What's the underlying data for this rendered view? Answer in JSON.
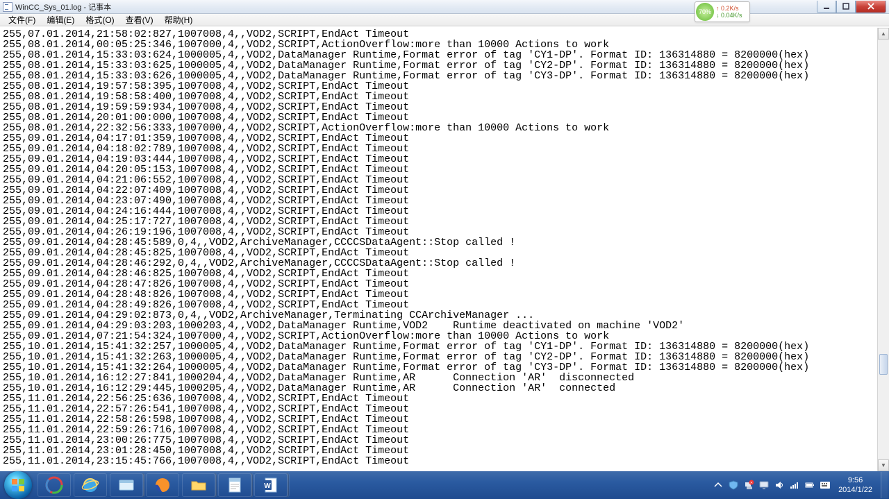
{
  "window": {
    "title": "WinCC_Sys_01.log - 记事本"
  },
  "menu": {
    "file": "文件(F)",
    "edit": "编辑(E)",
    "format": "格式(O)",
    "view": "查看(V)",
    "help": "帮助(H)"
  },
  "netmeter": {
    "pct": "70%",
    "up": "↑  0.2K/s",
    "dn": "↓ 0.04K/s"
  },
  "clock": {
    "time": "9:56",
    "date": "2014/1/22"
  },
  "log_lines": [
    "255,07.01.2014,21:58:02:827,1007008,4,,VOD2,SCRIPT,EndAct Timeout",
    "255,08.01.2014,00:05:25:346,1007000,4,,VOD2,SCRIPT,ActionOverflow:more than 10000 Actions to work",
    "255,08.01.2014,15:33:03:624,1000005,4,,VOD2,DataManager Runtime,Format error of tag 'CY1-DP'. Format ID: 136314880 = 8200000(hex)",
    "255,08.01.2014,15:33:03:625,1000005,4,,VOD2,DataManager Runtime,Format error of tag 'CY2-DP'. Format ID: 136314880 = 8200000(hex)",
    "255,08.01.2014,15:33:03:626,1000005,4,,VOD2,DataManager Runtime,Format error of tag 'CY3-DP'. Format ID: 136314880 = 8200000(hex)",
    "255,08.01.2014,19:57:58:395,1007008,4,,VOD2,SCRIPT,EndAct Timeout",
    "255,08.01.2014,19:58:58:400,1007008,4,,VOD2,SCRIPT,EndAct Timeout",
    "255,08.01.2014,19:59:59:934,1007008,4,,VOD2,SCRIPT,EndAct Timeout",
    "255,08.01.2014,20:01:00:000,1007008,4,,VOD2,SCRIPT,EndAct Timeout",
    "255,08.01.2014,22:32:56:333,1007000,4,,VOD2,SCRIPT,ActionOverflow:more than 10000 Actions to work",
    "255,09.01.2014,04:17:01:359,1007008,4,,VOD2,SCRIPT,EndAct Timeout",
    "255,09.01.2014,04:18:02:789,1007008,4,,VOD2,SCRIPT,EndAct Timeout",
    "255,09.01.2014,04:19:03:444,1007008,4,,VOD2,SCRIPT,EndAct Timeout",
    "255,09.01.2014,04:20:05:153,1007008,4,,VOD2,SCRIPT,EndAct Timeout",
    "255,09.01.2014,04:21:06:552,1007008,4,,VOD2,SCRIPT,EndAct Timeout",
    "255,09.01.2014,04:22:07:409,1007008,4,,VOD2,SCRIPT,EndAct Timeout",
    "255,09.01.2014,04:23:07:490,1007008,4,,VOD2,SCRIPT,EndAct Timeout",
    "255,09.01.2014,04:24:16:444,1007008,4,,VOD2,SCRIPT,EndAct Timeout",
    "255,09.01.2014,04:25:17:727,1007008,4,,VOD2,SCRIPT,EndAct Timeout",
    "255,09.01.2014,04:26:19:196,1007008,4,,VOD2,SCRIPT,EndAct Timeout",
    "255,09.01.2014,04:28:45:589,0,4,,VOD2,ArchiveManager,CCCCSDataAgent::Stop called !",
    "255,09.01.2014,04:28:45:825,1007008,4,,VOD2,SCRIPT,EndAct Timeout",
    "255,09.01.2014,04:28:46:292,0,4,,VOD2,ArchiveManager,CCCCSDataAgent::Stop called !",
    "255,09.01.2014,04:28:46:825,1007008,4,,VOD2,SCRIPT,EndAct Timeout",
    "255,09.01.2014,04:28:47:826,1007008,4,,VOD2,SCRIPT,EndAct Timeout",
    "255,09.01.2014,04:28:48:826,1007008,4,,VOD2,SCRIPT,EndAct Timeout",
    "255,09.01.2014,04:28:49:826,1007008,4,,VOD2,SCRIPT,EndAct Timeout",
    "255,09.01.2014,04:29:02:873,0,4,,VOD2,ArchiveManager,Terminating CCArchiveManager ...",
    "255,09.01.2014,04:29:03:203,1000203,4,,VOD2,DataManager Runtime,VOD2    Runtime deactivated on machine 'VOD2'",
    "255,09.01.2014,07:21:54:324,1007000,4,,VOD2,SCRIPT,ActionOverflow:more than 10000 Actions to work",
    "255,10.01.2014,15:41:32:257,1000005,4,,VOD2,DataManager Runtime,Format error of tag 'CY1-DP'. Format ID: 136314880 = 8200000(hex)",
    "255,10.01.2014,15:41:32:263,1000005,4,,VOD2,DataManager Runtime,Format error of tag 'CY2-DP'. Format ID: 136314880 = 8200000(hex)",
    "255,10.01.2014,15:41:32:264,1000005,4,,VOD2,DataManager Runtime,Format error of tag 'CY3-DP'. Format ID: 136314880 = 8200000(hex)",
    "255,10.01.2014,16:12:27:841,1000204,4,,VOD2,DataManager Runtime,AR      Connection 'AR'  disconnected",
    "255,10.01.2014,16:12:29:445,1000205,4,,VOD2,DataManager Runtime,AR      Connection 'AR'  connected",
    "255,11.01.2014,22:56:25:636,1007008,4,,VOD2,SCRIPT,EndAct Timeout",
    "255,11.01.2014,22:57:26:541,1007008,4,,VOD2,SCRIPT,EndAct Timeout",
    "255,11.01.2014,22:58:26:598,1007008,4,,VOD2,SCRIPT,EndAct Timeout",
    "255,11.01.2014,22:59:26:716,1007008,4,,VOD2,SCRIPT,EndAct Timeout",
    "255,11.01.2014,23:00:26:775,1007008,4,,VOD2,SCRIPT,EndAct Timeout",
    "255,11.01.2014,23:01:28:450,1007008,4,,VOD2,SCRIPT,EndAct Timeout",
    "255,11.01.2014,23:15:45:766,1007008,4,,VOD2,SCRIPT,EndAct Timeout"
  ]
}
